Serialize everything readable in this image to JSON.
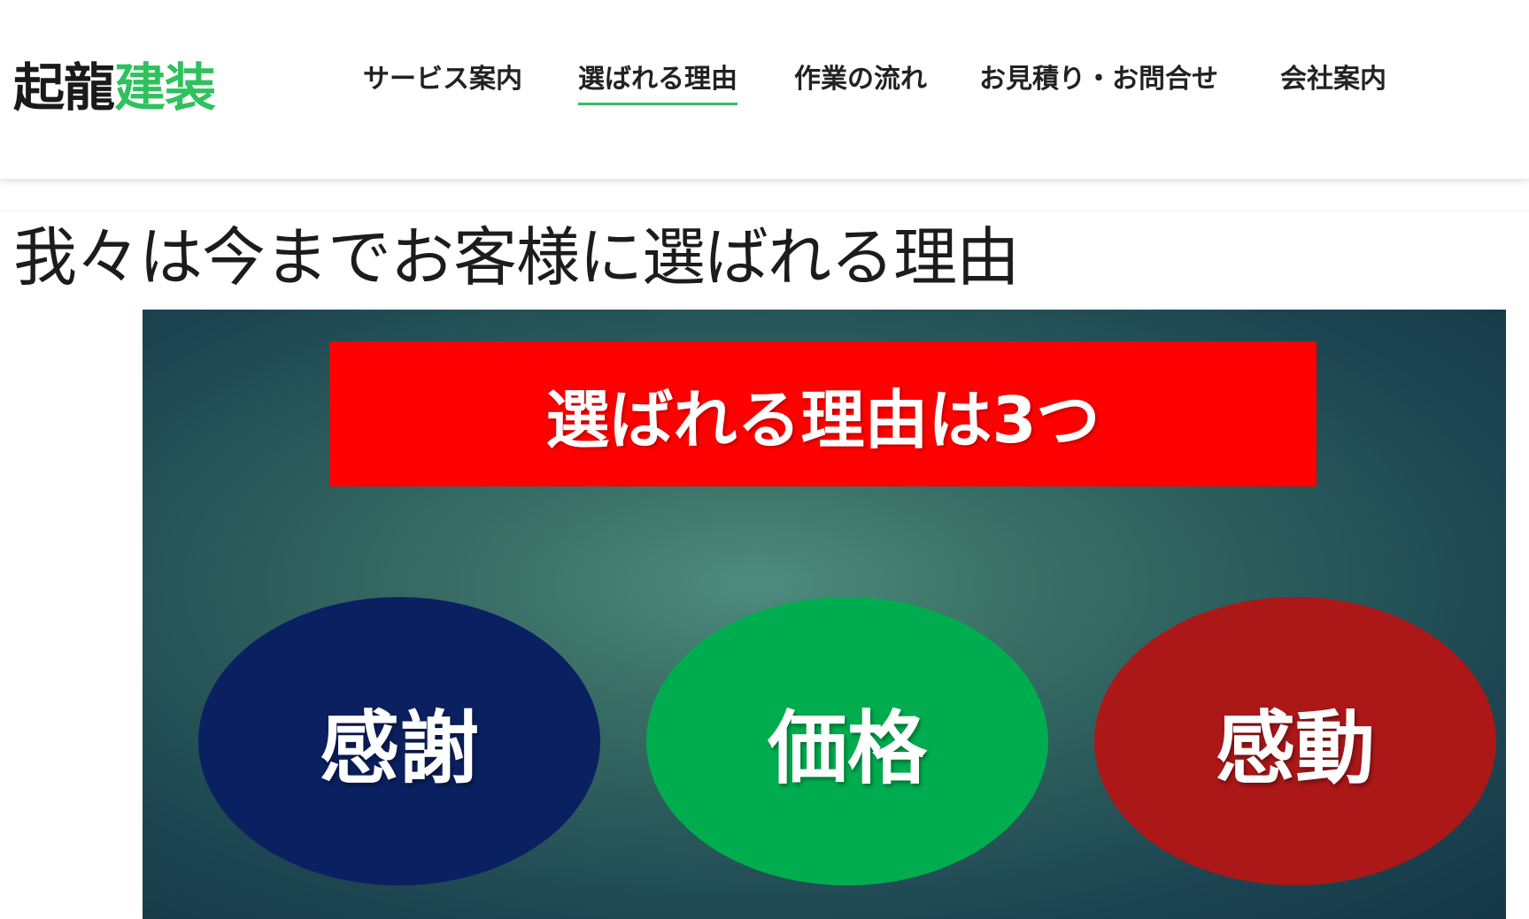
{
  "header": {
    "logo_part1": "起龍",
    "logo_part2": "建装",
    "nav": [
      {
        "label": "サービス案内"
      },
      {
        "label": "選ばれる理由"
      },
      {
        "label": "作業の流れ"
      },
      {
        "label": "お見積り・お問合せ"
      },
      {
        "label": "会社案内"
      }
    ],
    "active_nav": "選ばれる理由"
  },
  "page": {
    "title": "我々は今までお客様に選ばれる理由"
  },
  "hero": {
    "banner_text": "選ばれる理由は3つ",
    "reasons": [
      {
        "label": "感謝",
        "color": "#0a2060"
      },
      {
        "label": "価格",
        "color": "#00ad4e"
      },
      {
        "label": "感動",
        "color": "#ac1718"
      }
    ]
  },
  "colors": {
    "accent_green": "#2ec15e",
    "banner_red": "#ff0000"
  }
}
